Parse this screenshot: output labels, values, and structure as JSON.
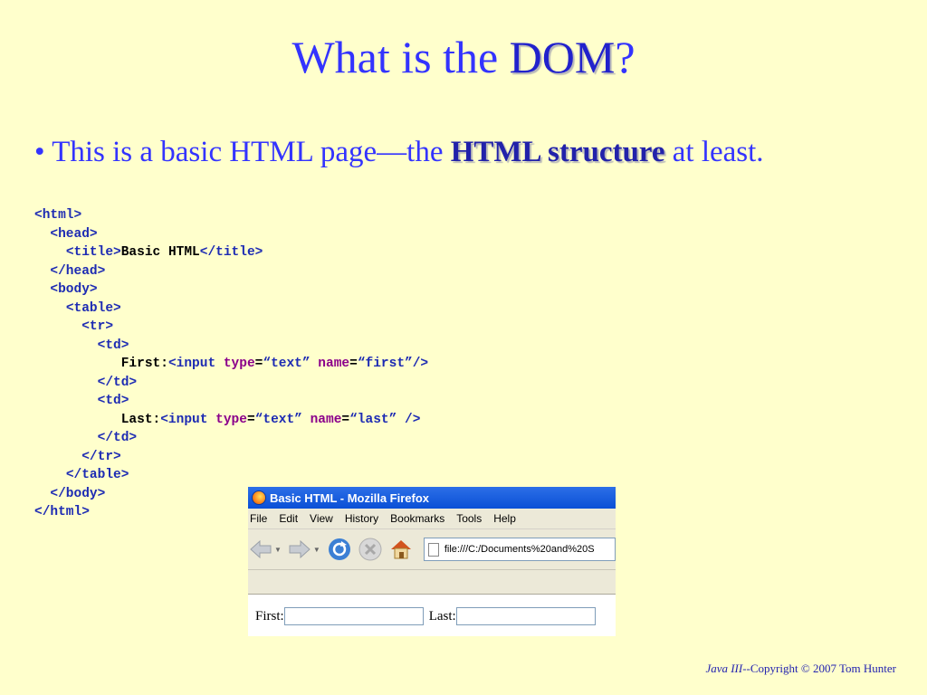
{
  "slide": {
    "title_before": "What is the ",
    "title_emph": "DOM",
    "title_after": "?",
    "bullet_prefix": "• This is a basic HTML page—the ",
    "bullet_emph": "HTML structure",
    "bullet_suffix": " at least."
  },
  "code": {
    "html_open": "<html>",
    "head_open": "<head>",
    "title_open": "<title>",
    "title_text": "Basic HTML",
    "title_close": "</title>",
    "head_close": "</head>",
    "body_open": "<body>",
    "table_open": "<table>",
    "tr_open": "<tr>",
    "td_open": "<td>",
    "first_label": "First:",
    "input_open": "<input ",
    "attr_type": "type",
    "eq": "=",
    "val_text": "“text”",
    "attr_name": "name",
    "val_first": "“first”",
    "self_close": "/>",
    "td_close": "</td>",
    "last_label": "Last:",
    "val_last": "“last”",
    "tr_close": "</tr>",
    "table_close": "</table>",
    "body_close": "</body>",
    "html_close": "</html>"
  },
  "browser": {
    "window_title": "Basic HTML - Mozilla Firefox",
    "menu": [
      "File",
      "Edit",
      "View",
      "History",
      "Bookmarks",
      "Tools",
      "Help"
    ],
    "url": "file:///C:/Documents%20and%20S",
    "first_label": "First:",
    "last_label": "Last:"
  },
  "footer": {
    "course": "Java III",
    "copyright": "--Copyright © 2007 Tom Hunter"
  },
  "colors": {
    "background": "#ffffcc",
    "heading": "#3333ff",
    "tag": "#1d2bb3",
    "attribute": "#8b008b"
  }
}
